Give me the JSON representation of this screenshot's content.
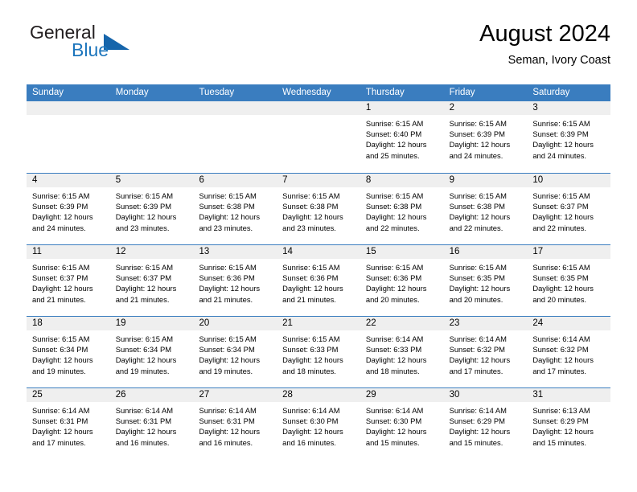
{
  "brand": {
    "name_part1": "General",
    "name_part2": "Blue",
    "flag_icon": "triangle-flag-icon"
  },
  "header": {
    "title": "August 2024",
    "subtitle": "Seman, Ivory Coast"
  },
  "colors": {
    "header_blue": "#3a7dbf",
    "brand_blue": "#1c75bc",
    "day_band": "#efefef"
  },
  "weekdays": [
    "Sunday",
    "Monday",
    "Tuesday",
    "Wednesday",
    "Thursday",
    "Friday",
    "Saturday"
  ],
  "weeks": [
    [
      {
        "day": "",
        "sunrise": "",
        "sunset": "",
        "daylight_line1": "",
        "daylight_line2": ""
      },
      {
        "day": "",
        "sunrise": "",
        "sunset": "",
        "daylight_line1": "",
        "daylight_line2": ""
      },
      {
        "day": "",
        "sunrise": "",
        "sunset": "",
        "daylight_line1": "",
        "daylight_line2": ""
      },
      {
        "day": "",
        "sunrise": "",
        "sunset": "",
        "daylight_line1": "",
        "daylight_line2": ""
      },
      {
        "day": "1",
        "sunrise": "Sunrise: 6:15 AM",
        "sunset": "Sunset: 6:40 PM",
        "daylight_line1": "Daylight: 12 hours",
        "daylight_line2": "and 25 minutes."
      },
      {
        "day": "2",
        "sunrise": "Sunrise: 6:15 AM",
        "sunset": "Sunset: 6:39 PM",
        "daylight_line1": "Daylight: 12 hours",
        "daylight_line2": "and 24 minutes."
      },
      {
        "day": "3",
        "sunrise": "Sunrise: 6:15 AM",
        "sunset": "Sunset: 6:39 PM",
        "daylight_line1": "Daylight: 12 hours",
        "daylight_line2": "and 24 minutes."
      }
    ],
    [
      {
        "day": "4",
        "sunrise": "Sunrise: 6:15 AM",
        "sunset": "Sunset: 6:39 PM",
        "daylight_line1": "Daylight: 12 hours",
        "daylight_line2": "and 24 minutes."
      },
      {
        "day": "5",
        "sunrise": "Sunrise: 6:15 AM",
        "sunset": "Sunset: 6:39 PM",
        "daylight_line1": "Daylight: 12 hours",
        "daylight_line2": "and 23 minutes."
      },
      {
        "day": "6",
        "sunrise": "Sunrise: 6:15 AM",
        "sunset": "Sunset: 6:38 PM",
        "daylight_line1": "Daylight: 12 hours",
        "daylight_line2": "and 23 minutes."
      },
      {
        "day": "7",
        "sunrise": "Sunrise: 6:15 AM",
        "sunset": "Sunset: 6:38 PM",
        "daylight_line1": "Daylight: 12 hours",
        "daylight_line2": "and 23 minutes."
      },
      {
        "day": "8",
        "sunrise": "Sunrise: 6:15 AM",
        "sunset": "Sunset: 6:38 PM",
        "daylight_line1": "Daylight: 12 hours",
        "daylight_line2": "and 22 minutes."
      },
      {
        "day": "9",
        "sunrise": "Sunrise: 6:15 AM",
        "sunset": "Sunset: 6:38 PM",
        "daylight_line1": "Daylight: 12 hours",
        "daylight_line2": "and 22 minutes."
      },
      {
        "day": "10",
        "sunrise": "Sunrise: 6:15 AM",
        "sunset": "Sunset: 6:37 PM",
        "daylight_line1": "Daylight: 12 hours",
        "daylight_line2": "and 22 minutes."
      }
    ],
    [
      {
        "day": "11",
        "sunrise": "Sunrise: 6:15 AM",
        "sunset": "Sunset: 6:37 PM",
        "daylight_line1": "Daylight: 12 hours",
        "daylight_line2": "and 21 minutes."
      },
      {
        "day": "12",
        "sunrise": "Sunrise: 6:15 AM",
        "sunset": "Sunset: 6:37 PM",
        "daylight_line1": "Daylight: 12 hours",
        "daylight_line2": "and 21 minutes."
      },
      {
        "day": "13",
        "sunrise": "Sunrise: 6:15 AM",
        "sunset": "Sunset: 6:36 PM",
        "daylight_line1": "Daylight: 12 hours",
        "daylight_line2": "and 21 minutes."
      },
      {
        "day": "14",
        "sunrise": "Sunrise: 6:15 AM",
        "sunset": "Sunset: 6:36 PM",
        "daylight_line1": "Daylight: 12 hours",
        "daylight_line2": "and 21 minutes."
      },
      {
        "day": "15",
        "sunrise": "Sunrise: 6:15 AM",
        "sunset": "Sunset: 6:36 PM",
        "daylight_line1": "Daylight: 12 hours",
        "daylight_line2": "and 20 minutes."
      },
      {
        "day": "16",
        "sunrise": "Sunrise: 6:15 AM",
        "sunset": "Sunset: 6:35 PM",
        "daylight_line1": "Daylight: 12 hours",
        "daylight_line2": "and 20 minutes."
      },
      {
        "day": "17",
        "sunrise": "Sunrise: 6:15 AM",
        "sunset": "Sunset: 6:35 PM",
        "daylight_line1": "Daylight: 12 hours",
        "daylight_line2": "and 20 minutes."
      }
    ],
    [
      {
        "day": "18",
        "sunrise": "Sunrise: 6:15 AM",
        "sunset": "Sunset: 6:34 PM",
        "daylight_line1": "Daylight: 12 hours",
        "daylight_line2": "and 19 minutes."
      },
      {
        "day": "19",
        "sunrise": "Sunrise: 6:15 AM",
        "sunset": "Sunset: 6:34 PM",
        "daylight_line1": "Daylight: 12 hours",
        "daylight_line2": "and 19 minutes."
      },
      {
        "day": "20",
        "sunrise": "Sunrise: 6:15 AM",
        "sunset": "Sunset: 6:34 PM",
        "daylight_line1": "Daylight: 12 hours",
        "daylight_line2": "and 19 minutes."
      },
      {
        "day": "21",
        "sunrise": "Sunrise: 6:15 AM",
        "sunset": "Sunset: 6:33 PM",
        "daylight_line1": "Daylight: 12 hours",
        "daylight_line2": "and 18 minutes."
      },
      {
        "day": "22",
        "sunrise": "Sunrise: 6:14 AM",
        "sunset": "Sunset: 6:33 PM",
        "daylight_line1": "Daylight: 12 hours",
        "daylight_line2": "and 18 minutes."
      },
      {
        "day": "23",
        "sunrise": "Sunrise: 6:14 AM",
        "sunset": "Sunset: 6:32 PM",
        "daylight_line1": "Daylight: 12 hours",
        "daylight_line2": "and 17 minutes."
      },
      {
        "day": "24",
        "sunrise": "Sunrise: 6:14 AM",
        "sunset": "Sunset: 6:32 PM",
        "daylight_line1": "Daylight: 12 hours",
        "daylight_line2": "and 17 minutes."
      }
    ],
    [
      {
        "day": "25",
        "sunrise": "Sunrise: 6:14 AM",
        "sunset": "Sunset: 6:31 PM",
        "daylight_line1": "Daylight: 12 hours",
        "daylight_line2": "and 17 minutes."
      },
      {
        "day": "26",
        "sunrise": "Sunrise: 6:14 AM",
        "sunset": "Sunset: 6:31 PM",
        "daylight_line1": "Daylight: 12 hours",
        "daylight_line2": "and 16 minutes."
      },
      {
        "day": "27",
        "sunrise": "Sunrise: 6:14 AM",
        "sunset": "Sunset: 6:31 PM",
        "daylight_line1": "Daylight: 12 hours",
        "daylight_line2": "and 16 minutes."
      },
      {
        "day": "28",
        "sunrise": "Sunrise: 6:14 AM",
        "sunset": "Sunset: 6:30 PM",
        "daylight_line1": "Daylight: 12 hours",
        "daylight_line2": "and 16 minutes."
      },
      {
        "day": "29",
        "sunrise": "Sunrise: 6:14 AM",
        "sunset": "Sunset: 6:30 PM",
        "daylight_line1": "Daylight: 12 hours",
        "daylight_line2": "and 15 minutes."
      },
      {
        "day": "30",
        "sunrise": "Sunrise: 6:14 AM",
        "sunset": "Sunset: 6:29 PM",
        "daylight_line1": "Daylight: 12 hours",
        "daylight_line2": "and 15 minutes."
      },
      {
        "day": "31",
        "sunrise": "Sunrise: 6:13 AM",
        "sunset": "Sunset: 6:29 PM",
        "daylight_line1": "Daylight: 12 hours",
        "daylight_line2": "and 15 minutes."
      }
    ]
  ]
}
